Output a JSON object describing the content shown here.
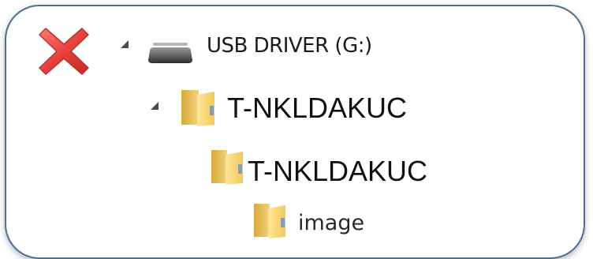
{
  "status": {
    "error_icon": "red-x-icon",
    "error_color": "#e8413c"
  },
  "tree": {
    "drive": {
      "label": "USB DRIVER (G:)",
      "icon": "usb-drive-icon",
      "expanded": true
    },
    "folder_1": {
      "label": "T-NKLDAKUC",
      "icon": "folder-icon",
      "expanded": true
    },
    "folder_2": {
      "label": "T-NKLDAKUC",
      "icon": "folder-icon"
    },
    "folder_3": {
      "label": "image",
      "icon": "folder-icon"
    }
  }
}
